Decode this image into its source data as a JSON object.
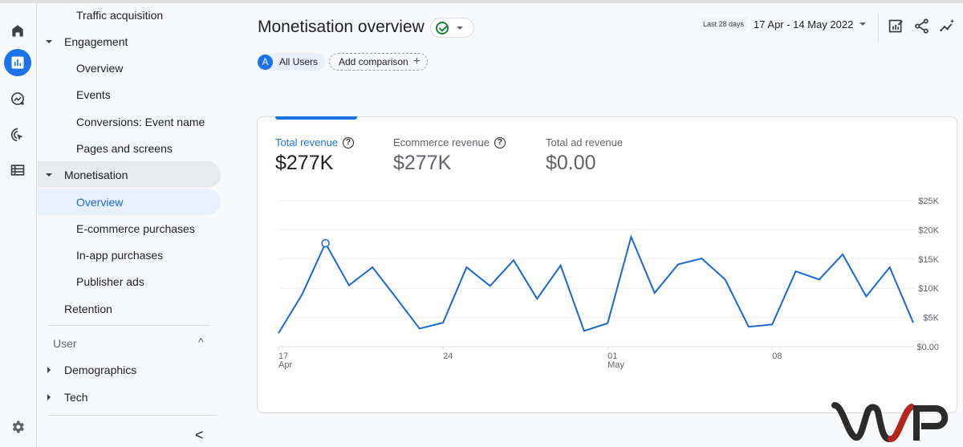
{
  "nav": {
    "items": [
      {
        "label": "Traffic acquisition",
        "level": "sub"
      },
      {
        "label": "Engagement",
        "level": "top",
        "caret": "down"
      },
      {
        "label": "Overview",
        "level": "sub"
      },
      {
        "label": "Events",
        "level": "sub"
      },
      {
        "label": "Conversions: Event name",
        "level": "sub"
      },
      {
        "label": "Pages and screens",
        "level": "sub"
      },
      {
        "label": "Monetisation",
        "level": "top",
        "caret": "down",
        "state": "highlighted"
      },
      {
        "label": "Overview",
        "level": "sub",
        "state": "selected"
      },
      {
        "label": "E-commerce purchases",
        "level": "sub"
      },
      {
        "label": "In-app purchases",
        "level": "sub"
      },
      {
        "label": "Publisher ads",
        "level": "sub"
      },
      {
        "label": "Retention",
        "level": "top"
      }
    ],
    "user_section": {
      "heading": "User",
      "toggle": "^",
      "items": [
        {
          "label": "Demographics",
          "caret": "right"
        },
        {
          "label": "Tech",
          "caret": "right"
        }
      ]
    },
    "collapse_glyph": "<"
  },
  "rail": {
    "icons": [
      "home-icon",
      "reports-icon",
      "explore-icon",
      "advertising-icon",
      "configure-icon"
    ],
    "active": "reports-icon",
    "settings": "settings-icon"
  },
  "header": {
    "title": "Monetisation overview",
    "comparison": {
      "segment_avatar": "A",
      "segment_label": "All Users",
      "add_label": "Add comparison",
      "add_glyph": "+"
    },
    "date": {
      "badge": "Last 28 days",
      "range": "17 Apr - 14 May 2022"
    }
  },
  "card": {
    "metrics": [
      {
        "label": "Total revenue",
        "value": "$277K",
        "help": true,
        "active": true
      },
      {
        "label": "Ecommerce revenue",
        "value": "$277K",
        "help": true,
        "active": false
      },
      {
        "label": "Total ad revenue",
        "value": "$0.00",
        "help": false,
        "active": false
      }
    ],
    "help_glyph": "?"
  },
  "colors": {
    "accent": "#1a73e8",
    "line": "#1967d2",
    "success": "#188038",
    "logo_dark": "#2b2b2b",
    "logo_red": "#b3261e"
  },
  "chart_data": {
    "type": "line",
    "title": "",
    "xlabel": "",
    "ylabel": "",
    "ylim": [
      0,
      25000
    ],
    "y_ticks": [
      {
        "value": 25000,
        "label": "$25K"
      },
      {
        "value": 20000,
        "label": "$20K"
      },
      {
        "value": 15000,
        "label": "$15K"
      },
      {
        "value": 10000,
        "label": "$10K"
      },
      {
        "value": 5000,
        "label": "$5K"
      },
      {
        "value": 0,
        "label": "$0.00"
      }
    ],
    "x_ticks": [
      {
        "index": 0,
        "label": "17",
        "sub": "Apr"
      },
      {
        "index": 7,
        "label": "24",
        "sub": ""
      },
      {
        "index": 14,
        "label": "01",
        "sub": "May"
      },
      {
        "index": 21,
        "label": "08",
        "sub": ""
      }
    ],
    "grid": true,
    "legend": "none",
    "x": [
      "17 Apr",
      "18 Apr",
      "19 Apr",
      "20 Apr",
      "21 Apr",
      "22 Apr",
      "23 Apr",
      "24 Apr",
      "25 Apr",
      "26 Apr",
      "27 Apr",
      "28 Apr",
      "29 Apr",
      "30 Apr",
      "01 May",
      "02 May",
      "03 May",
      "04 May",
      "05 May",
      "06 May",
      "07 May",
      "08 May",
      "09 May",
      "10 May",
      "11 May",
      "12 May",
      "13 May",
      "14 May"
    ],
    "series": [
      {
        "name": "Total revenue",
        "values": [
          2300,
          8900,
          17700,
          10500,
          13600,
          8400,
          3100,
          4100,
          13600,
          10400,
          14800,
          8200,
          13900,
          2700,
          4000,
          18800,
          9200,
          14100,
          15100,
          11500,
          3400,
          3800,
          12900,
          11500,
          15800,
          8600,
          13600,
          4100
        ],
        "highlight_index": 2
      }
    ]
  }
}
